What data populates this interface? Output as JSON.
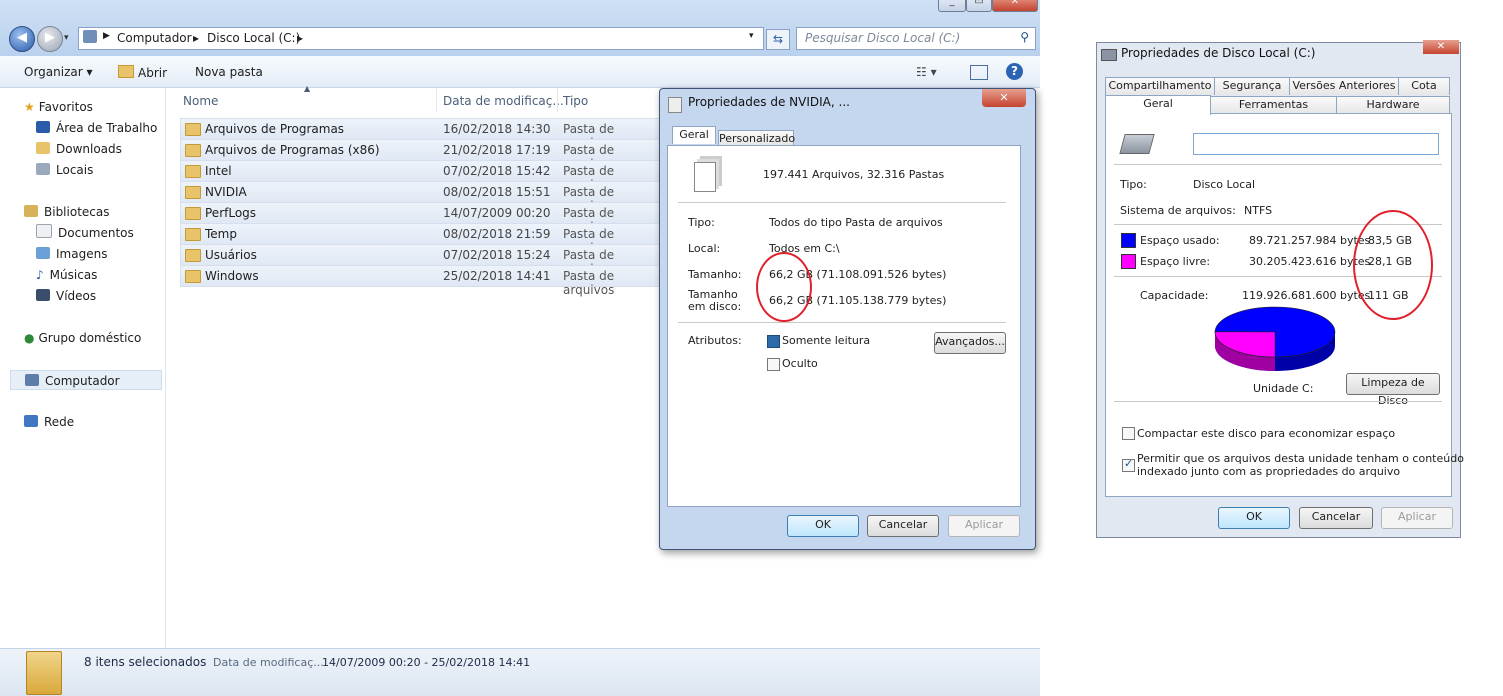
{
  "explorer": {
    "address": [
      "Computador",
      "Disco Local (C:)"
    ],
    "search_placeholder": "Pesquisar Disco Local (C:)",
    "toolbar": {
      "organize": "Organizar",
      "open": "Abrir",
      "new_folder": "Nova pasta"
    },
    "columns": {
      "name": "Nome",
      "date": "Data de modificaç...",
      "type": "Tipo"
    },
    "sidebar": {
      "favorites": "Favoritos",
      "desktop": "Área de Trabalho",
      "downloads": "Downloads",
      "places": "Locais",
      "libraries": "Bibliotecas",
      "documents": "Documentos",
      "images": "Imagens",
      "music": "Músicas",
      "videos": "Vídeos",
      "homegroup": "Grupo doméstico",
      "computer": "Computador",
      "network": "Rede"
    },
    "files": [
      {
        "name": "Arquivos de Programas",
        "date": "16/02/2018 14:30",
        "type": "Pasta de arquivos"
      },
      {
        "name": "Arquivos de Programas (x86)",
        "date": "21/02/2018 17:19",
        "type": "Pasta de arquivos"
      },
      {
        "name": "Intel",
        "date": "07/02/2018 15:42",
        "type": "Pasta de arquivos"
      },
      {
        "name": "NVIDIA",
        "date": "08/02/2018 15:51",
        "type": "Pasta de arquivos"
      },
      {
        "name": "PerfLogs",
        "date": "14/07/2009 00:20",
        "type": "Pasta de arquivos"
      },
      {
        "name": "Temp",
        "date": "08/02/2018 21:59",
        "type": "Pasta de arquivos"
      },
      {
        "name": "Usuários",
        "date": "07/02/2018 15:24",
        "type": "Pasta de arquivos"
      },
      {
        "name": "Windows",
        "date": "25/02/2018 14:41",
        "type": "Pasta de arquivos"
      }
    ],
    "status": {
      "selected": "8 itens selecionados",
      "date_label": "Data de modificaç...",
      "date_range": "14/07/2009 00:20 - 25/02/2018 14:41"
    }
  },
  "nvidia_dialog": {
    "title": "Propriedades de NVIDIA, ...",
    "tabs": [
      "Geral",
      "Personalizado"
    ],
    "summary": "197.441 Arquivos, 32.316 Pastas",
    "type_label": "Tipo:",
    "type_value": "Todos do tipo Pasta de arquivos",
    "location_label": "Local:",
    "location_value": "Todos em C:\\",
    "size_label": "Tamanho:",
    "size_value": "66,2 GB (71.108.091.526 bytes)",
    "disk_size_label_1": "Tamanho",
    "disk_size_label_2": "em disco:",
    "disk_size_value": "66,2 GB (71.105.138.779 bytes)",
    "attributes_label": "Atributos:",
    "readonly": "Somente leitura",
    "hidden": "Oculto",
    "advanced": "Avançados...",
    "ok": "OK",
    "cancel": "Cancelar",
    "apply": "Aplicar"
  },
  "disk_dialog": {
    "title": "Propriedades de Disco Local (C:)",
    "tabs_row1": [
      "Compartilhamento",
      "Segurança",
      "Versões Anteriores",
      "Cota"
    ],
    "tabs_row2": [
      "Geral",
      "Ferramentas",
      "Hardware"
    ],
    "label_value": "",
    "type_label": "Tipo:",
    "type_value": "Disco Local",
    "fs_label": "Sistema de arquivos:",
    "fs_value": "NTFS",
    "used_label": "Espaço usado:",
    "used_bytes": "89.721.257.984 bytes",
    "used_gb": "83,5 GB",
    "free_label": "Espaço livre:",
    "free_bytes": "30.205.423.616 bytes",
    "free_gb": "28,1 GB",
    "capacity_label": "Capacidade:",
    "capacity_bytes": "119.926.681.600 bytes",
    "capacity_gb": "111 GB",
    "drive_label": "Unidade C:",
    "cleanup": "Limpeza de Disco",
    "compress": "Compactar este disco para economizar espaço",
    "index_1": "Permitir que os arquivos desta unidade tenham o conteúdo",
    "index_2": "indexado junto com as propriedades do arquivo",
    "ok": "OK",
    "cancel": "Cancelar",
    "apply": "Aplicar",
    "colors": {
      "used": "#0000ff",
      "free": "#ff00ff"
    },
    "used_fraction": 0.748
  }
}
